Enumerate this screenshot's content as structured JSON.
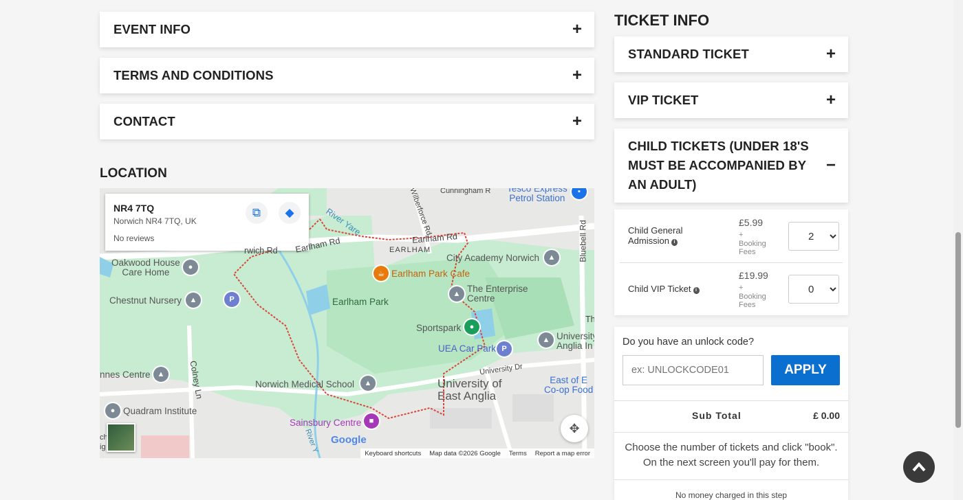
{
  "accordions": {
    "event_info": "EVENT INFO",
    "terms": "TERMS AND CONDITIONS",
    "contact": "CONTACT",
    "plus": "+"
  },
  "location": {
    "heading": "LOCATION",
    "card": {
      "title": "NR4 7TQ",
      "address": "Norwich NR4 7TQ, UK",
      "reviews": "No reviews"
    },
    "labels": {
      "oakwood": "Oakwood House\nCare Home",
      "chestnut": "Chestnut Nursery",
      "earlham_rd": "Earlham Rd",
      "earlham_rd2": "Earlham Rd",
      "earlham_upper": "EARLHAM",
      "city_academy": "City Academy Norwich",
      "earlham_cafe": "Earlham Park Cafe",
      "enterprise": "The Enterprise\nCentre",
      "earlham_park": "Earlham Park",
      "sportspark": "Sportspark",
      "uea_car_park": "UEA Car Park",
      "university_dr": "University Dr",
      "uea": "University of\nEast Anglia",
      "university_anglia": "University\nAnglia In",
      "east_coop": "East of E\nCo-op Food",
      "medical_school": "Norwich Medical School",
      "sainsbury": "Sainsbury Centre",
      "quadram": "Quadram Institute",
      "nnes_centre": "nnes Centre",
      "colney_ln": "Colney Ln",
      "bluebell_rd": "Bluebell Rd",
      "wilberforce": "Wilberforce Rd",
      "cunningham": "Cunningham R",
      "tesco": "Tesco Express\nPetrol Station",
      "river_yare": "River Yare",
      "river_yare2": "River Y",
      "earlham_rd_left": "rwich Rd",
      "th": "Th",
      "ch": "ch\nig"
    },
    "attribution": {
      "keyboard": "Keyboard shortcuts",
      "map_data": "Map data ©2026 Google",
      "terms": "Terms",
      "report": "Report a map error",
      "google": "Google"
    }
  },
  "tickets": {
    "heading": "TICKET INFO",
    "standard": "STANDARD TICKET",
    "vip": "VIP TICKET",
    "child_heading": "CHILD TICKETS (UNDER 18'S MUST BE ACCOMPANIED BY AN ADULT)",
    "minus": "−",
    "items": [
      {
        "name": "Child General Admission",
        "price": "£5.99",
        "fees": "+\nBooking\nFees",
        "qty": "2"
      },
      {
        "name": "Child VIP Ticket",
        "price": "£19.99",
        "fees": "+\nBooking\nFees",
        "qty": "0"
      }
    ],
    "unlock_question": "Do you have an unlock code?",
    "unlock_placeholder": "ex: UNLOCKCODE01",
    "apply": "APPLY",
    "subtotal_label": "Sub Total",
    "subtotal_value": "£ 0.00",
    "instructions": "Choose the number of tickets and click \"book\". On the next screen you'll pay for them.",
    "no_money": "No money charged in this step"
  },
  "colors": {
    "accent": "#0b6fcf",
    "map_green": "#c8ecd2",
    "route": "#d9463b"
  }
}
